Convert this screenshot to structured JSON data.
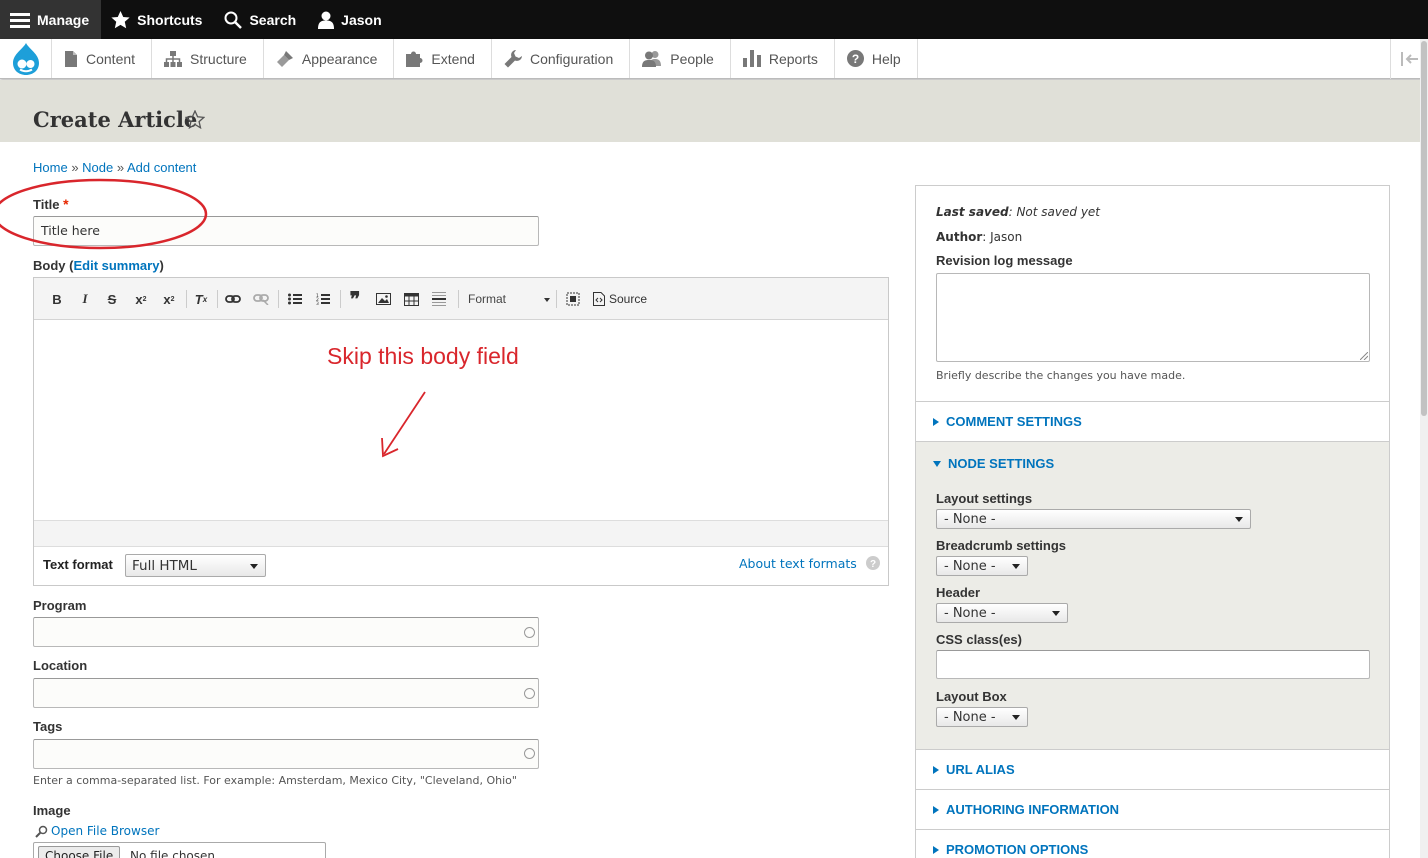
{
  "toolbar": {
    "manage": "Manage",
    "shortcuts": "Shortcuts",
    "search": "Search",
    "user": "Jason"
  },
  "tray": {
    "items": [
      "Content",
      "Structure",
      "Appearance",
      "Extend",
      "Configuration",
      "People",
      "Reports",
      "Help"
    ]
  },
  "page": {
    "title": "Create Article"
  },
  "breadcrumb": {
    "home": "Home",
    "node": "Node",
    "add_content": "Add content",
    "sep": "»"
  },
  "form": {
    "title_label": "Title",
    "title_required": "*",
    "title_value": "Title here",
    "body_label": "Body",
    "edit_summary": "Edit summary",
    "editor_format_label": "Format",
    "editor_source_label": "Source",
    "text_format_label": "Text format",
    "text_format_value": "Full HTML",
    "about_text_formats": "About text formats",
    "program_label": "Program",
    "location_label": "Location",
    "tags_label": "Tags",
    "tags_description": "Enter a comma-separated list. For example: Amsterdam, Mexico City, \"Cleveland, Ohio\"",
    "image_label": "Image",
    "open_file_browser": "Open File Browser",
    "choose_file": "Choose File",
    "no_file": "No file chosen"
  },
  "annotation": {
    "text": "Skip this body field",
    "color": "#d9262c"
  },
  "sidebar": {
    "last_saved_label": "Last saved",
    "last_saved_value": "Not saved yet",
    "author_label": "Author",
    "author_value": "Jason",
    "revision_label": "Revision log message",
    "revision_description": "Briefly describe the changes you have made.",
    "comment_settings": "Comment settings",
    "node_settings": "Node settings",
    "layout_settings_label": "Layout settings",
    "breadcrumb_settings_label": "Breadcrumb settings",
    "header_label": "Header",
    "css_classes_label": "CSS class(es)",
    "layout_box_label": "Layout Box",
    "none_option": "- None -",
    "url_alias": "URL alias",
    "authoring_information": "Authoring information",
    "promotion_options": "Promotion options"
  },
  "colors": {
    "link": "#0074bd",
    "toolbar_bg": "#0f0f0f",
    "header_bg": "#e0e0d8",
    "required": "#e62600"
  }
}
